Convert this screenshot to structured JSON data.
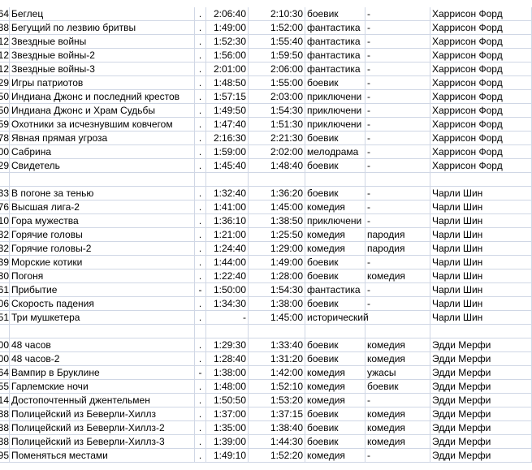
{
  "rows": [
    [
      "64",
      "Беглец",
      ".",
      "2:06:40",
      "2:10:30",
      "боевик",
      "-",
      "Харрисон Форд"
    ],
    [
      "38",
      "Бегущий по лезвию бритвы",
      ".",
      "1:49:00",
      "1:52:00",
      "фантастика",
      "-",
      "Харрисон Форд"
    ],
    [
      "12",
      "Звездные войны",
      ".",
      "1:52:30",
      "1:55:40",
      "фантастика",
      "-",
      "Харрисон Форд"
    ],
    [
      "12",
      "Звездные войны-2",
      ".",
      "1:56:00",
      "1:59:50",
      "фантастика",
      "-",
      "Харрисон Форд"
    ],
    [
      "12",
      "Звездные войны-3",
      ".",
      "2:01:00",
      "2:06:00",
      "фантастика",
      "-",
      "Харрисон Форд"
    ],
    [
      "29",
      "Игры патриотов",
      ".",
      "1:48:50",
      "1:55:00",
      "боевик",
      "-",
      "Харрисон Форд"
    ],
    [
      "50",
      "Индиана Джонс и последний крестов",
      ".",
      "1:57:15",
      "2:03:00",
      "приключени",
      "-",
      "Харрисон Форд"
    ],
    [
      "50",
      "Индиана Джонс и Храм Судьбы",
      ".",
      "1:49:50",
      "1:54:30",
      "приключени",
      "-",
      "Харрисон Форд"
    ],
    [
      "59",
      "Охотники за исчезнувшим ковчегом",
      ".",
      "1:47:40",
      "1:51:30",
      "приключени",
      "-",
      "Харрисон Форд"
    ],
    [
      "78",
      "Явная прямая угроза",
      ".",
      "2:16:30",
      "2:21:30",
      "боевик",
      "-",
      "Харрисон Форд"
    ],
    [
      "00",
      "Сабрина",
      ".",
      "1:59:00",
      "2:02:00",
      "мелодрама",
      "-",
      "Харрисон Форд"
    ],
    [
      "29",
      "Свидетель",
      ".",
      "1:45:40",
      "1:48:40",
      "боевик",
      "-",
      "Харрисон Форд"
    ],
    [
      "",
      "",
      "",
      "",
      "",
      "",
      "",
      ""
    ],
    [
      "33",
      "В погоне за тенью",
      ".",
      "1:32:40",
      "1:36:20",
      "боевик",
      "-",
      "Чарли Шин"
    ],
    [
      "76",
      "Высшая лига-2",
      ".",
      "1:41:00",
      "1:45:00",
      "комедия",
      "-",
      "Чарли Шин"
    ],
    [
      "10",
      "Гора мужества",
      ".",
      "1:36:10",
      "1:38:50",
      "приключени",
      "-",
      "Чарли Шин"
    ],
    [
      "32",
      "Горячие головы",
      ".",
      "1:21:00",
      "1:25:50",
      "комедия",
      "пародия",
      "Чарли Шин"
    ],
    [
      "32",
      "Горячие головы-2",
      ".",
      "1:24:40",
      "1:29:00",
      "комедия",
      "пародия",
      "Чарли Шин"
    ],
    [
      "39",
      "Морские котики",
      ".",
      "1:44:00",
      "1:49:00",
      "боевик",
      "-",
      "Чарли Шин"
    ],
    [
      "30",
      "Погоня",
      ".",
      "1:22:40",
      "1:28:00",
      "боевик",
      "комедия",
      "Чарли Шин"
    ],
    [
      "61",
      "Прибытие",
      "-",
      "1:50:00",
      "1:54:30",
      "фантастика",
      "-",
      "Чарли Шин"
    ],
    [
      "06",
      "Скорость падения",
      ".",
      "1:34:30",
      "1:38:00",
      "боевик",
      "-",
      "Чарли Шин"
    ],
    [
      "51",
      "Три мушкетера",
      ".",
      "-",
      "1:45:00",
      "исторический",
      "",
      "Чарли Шин"
    ],
    [
      "",
      "",
      "",
      "",
      "",
      "",
      "",
      ""
    ],
    [
      "00",
      "48 часов",
      ".",
      "1:29:30",
      "1:33:40",
      "боевик",
      "комедия",
      "Эдди Мерфи"
    ],
    [
      "00",
      "48 часов-2",
      ".",
      "1:28:40",
      "1:31:20",
      "боевик",
      "комедия",
      "Эдди Мерфи"
    ],
    [
      "64",
      "Вампир в Бруклине",
      "-",
      "1:38:00",
      "1:42:00",
      "комедия",
      "ужасы",
      "Эдди Мерфи"
    ],
    [
      "55",
      "Гарлемские ночи",
      ".",
      "1:48:00",
      "1:52:10",
      "комедия",
      "боевик",
      "Эдди Мерфи"
    ],
    [
      "14",
      "Достопочтенный джентельмен",
      ".",
      "1:50:50",
      "1:53:20",
      "комедия",
      "-",
      "Эдди Мерфи"
    ],
    [
      "38",
      "Полицейский из Беверли-Хиллз",
      ".",
      "1:37:00",
      "1:37:15",
      "боевик",
      "комедия",
      "Эдди Мерфи"
    ],
    [
      "38",
      "Полицейский из Беверли-Хиллз-2",
      ".",
      "1:35:00",
      "1:38:40",
      "боевик",
      "комедия",
      "Эдди Мерфи"
    ],
    [
      "38",
      "Полицейский из Беверли-Хиллз-3",
      ".",
      "1:39:00",
      "1:44:30",
      "боевик",
      "комедия",
      "Эдди Мерфи"
    ],
    [
      "95",
      "Поменяться местами",
      ".",
      "1:49:10",
      "1:52:20",
      "комедия",
      "-",
      "Эдди Мерфи"
    ]
  ]
}
